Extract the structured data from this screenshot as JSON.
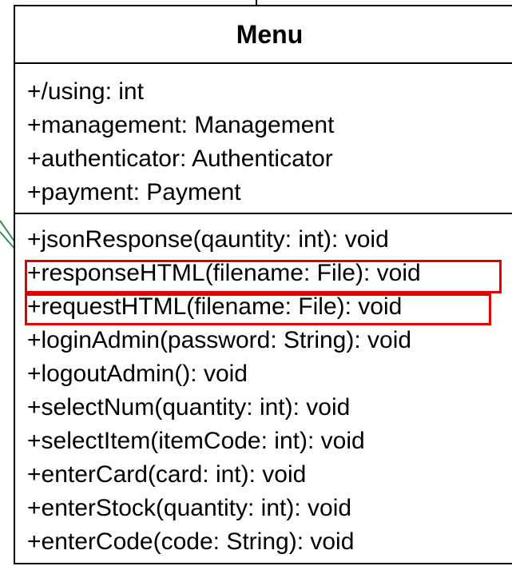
{
  "diagram": {
    "class_name": "Menu",
    "attributes": [
      "+/using: int",
      "+management: Management",
      "+authenticator: Authenticator",
      "+payment: Payment"
    ],
    "methods": [
      "+jsonResponse(qauntity: int): void",
      "+responseHTML(filename: File): void",
      "+requestHTML(filename: File): void",
      "+loginAdmin(password: String): void",
      "+logoutAdmin(): void",
      "+selectNum(quantity: int): void",
      "+selectItem(itemCode: int): void",
      "+enterCard(card: int): void",
      "+enterStock(quantity: int): void",
      "+enterCode(code: String): void"
    ],
    "highlighted_methods": [
      "+responseHTML(filename: File): void",
      "+requestHTML(filename: File): void"
    ],
    "colors": {
      "border": "#000000",
      "highlight": "#e00000",
      "connector": "#3c8a5a"
    }
  }
}
